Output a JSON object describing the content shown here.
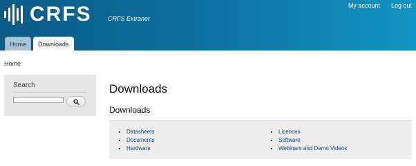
{
  "header": {
    "logo_text": "CRFS",
    "subtitle": "CRFS Extranet",
    "links": [
      "My account",
      "Log out"
    ]
  },
  "tabs": [
    {
      "label": "Home",
      "active": false
    },
    {
      "label": "Downloads",
      "active": true
    }
  ],
  "breadcrumb": {
    "home": "Home"
  },
  "sidebar": {
    "search": {
      "title": "Search",
      "value": "",
      "button_icon": "search-icon"
    }
  },
  "main": {
    "title": "Downloads",
    "section_title": "Downloads",
    "list_left": [
      "Datasheets",
      "Documents",
      "Hardware"
    ],
    "list_right": [
      "Licences",
      "Software",
      "Webinars and Demo Videos"
    ]
  },
  "colors": {
    "header_start": "#0a5b86",
    "header_end": "#1195c2",
    "link": "#1a3d6d",
    "panel_bg": "#eeeeee"
  }
}
